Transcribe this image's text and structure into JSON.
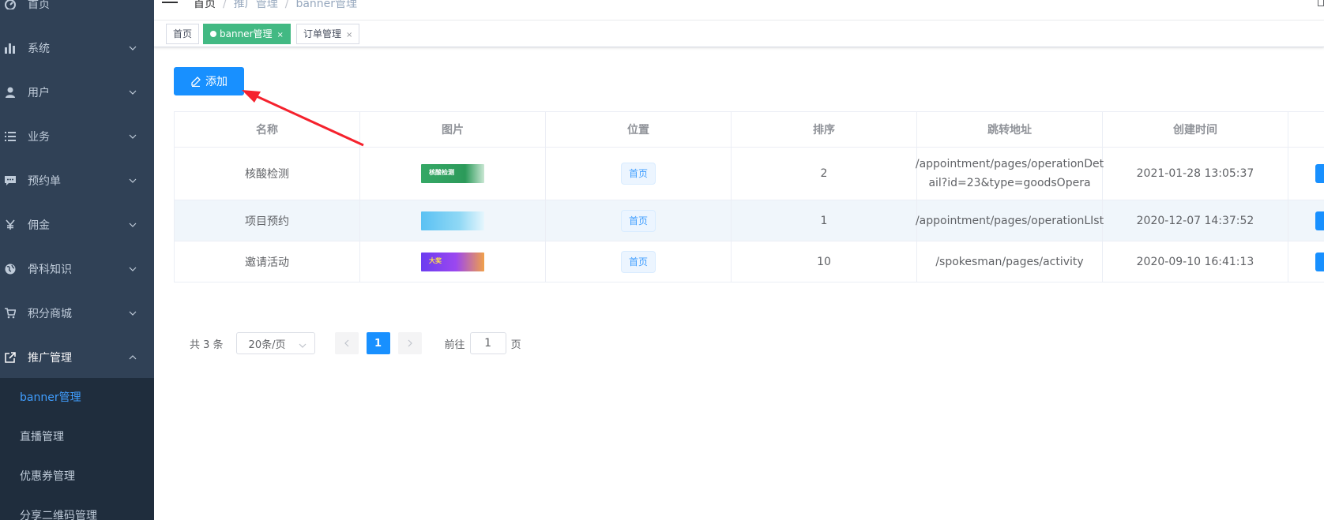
{
  "sidebar": {
    "items": [
      {
        "label": "首页",
        "icon": "dashboard-icon"
      },
      {
        "label": "系统",
        "icon": "bar-chart-icon"
      },
      {
        "label": "用户",
        "icon": "user-icon"
      },
      {
        "label": "业务",
        "icon": "list-icon"
      },
      {
        "label": "预约单",
        "icon": "message-icon"
      },
      {
        "label": "佣金",
        "icon": "yen-icon"
      },
      {
        "label": "骨科知识",
        "icon": "globe-icon"
      },
      {
        "label": "积分商城",
        "icon": "cart-icon"
      },
      {
        "label": "推广管理",
        "icon": "external-link-icon"
      }
    ],
    "submenu": [
      "banner管理",
      "直播管理",
      "优惠券管理",
      "分享二维码管理"
    ]
  },
  "breadcrumb": [
    "首页",
    "推广管理",
    "banner管理"
  ],
  "tags": [
    {
      "label": "首页"
    },
    {
      "label": "banner管理",
      "close": "×"
    },
    {
      "label": "订单管理",
      "close": "×"
    }
  ],
  "toolbar": {
    "add_label": "添加"
  },
  "table": {
    "headers": [
      "名称",
      "图片",
      "位置",
      "排序",
      "跳转地址",
      "创建时间"
    ],
    "rows": [
      {
        "name": "核酸检测",
        "thumb": "核酸检测",
        "position": "首页",
        "sort": "2",
        "url_line1": "/appointment/pages/operationDet",
        "url_line2": "ail?id=23&type=goodsOpera",
        "created": "2021-01-28 13:05:37"
      },
      {
        "name": "项目预约",
        "thumb": "",
        "position": "首页",
        "sort": "1",
        "url_line1": "/appointment/pages/operationLIst",
        "url_line2": "",
        "created": "2020-12-07 14:37:52"
      },
      {
        "name": "邀请活动",
        "thumb": "大奖",
        "position": "首页",
        "sort": "10",
        "url_line1": "/spokesman/pages/activity",
        "url_line2": "",
        "created": "2020-09-10 16:41:13"
      }
    ]
  },
  "pagination": {
    "total": "共 3 条",
    "page_size": "20条/页",
    "current": "1",
    "goto_prefix": "前往",
    "goto_value": "1",
    "goto_suffix": "页"
  },
  "colors": {
    "sidebar_bg": "#304156",
    "accent": "#1890ff",
    "active_tag": "#42b983",
    "annotation_arrow": "#f5222d"
  }
}
